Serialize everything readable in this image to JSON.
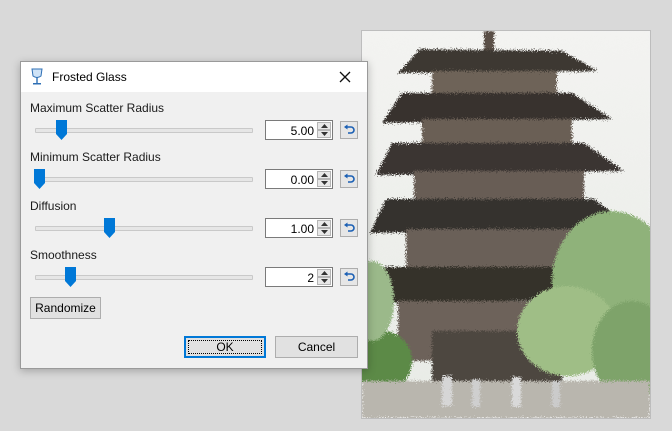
{
  "dialog": {
    "title": "Frosted Glass",
    "params": [
      {
        "label": "Maximum Scatter Radius",
        "value": "5.00",
        "slider_fraction": 0.12
      },
      {
        "label": "Minimum Scatter Radius",
        "value": "0.00",
        "slider_fraction": 0.02
      },
      {
        "label": "Diffusion",
        "value": "1.00",
        "slider_fraction": 0.34
      },
      {
        "label": "Smoothness",
        "value": "2",
        "slider_fraction": 0.16
      }
    ],
    "randomize_label": "Randomize",
    "ok_label": "OK",
    "cancel_label": "Cancel"
  },
  "colors": {
    "accent": "#0078d7",
    "reset_icon": "#1a5fb4"
  },
  "icons": {
    "app": "wine-glass-icon",
    "close": "close-icon",
    "reset": "undo-arrow-icon",
    "spin_up": "chevron-up-icon",
    "spin_down": "chevron-down-icon"
  }
}
